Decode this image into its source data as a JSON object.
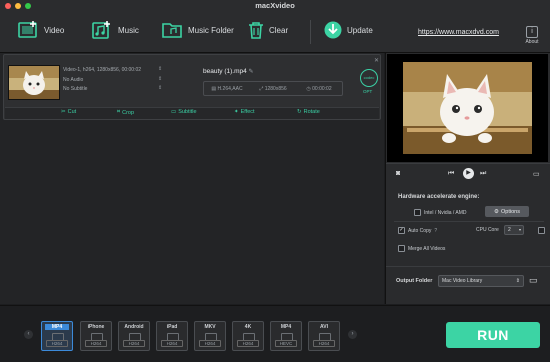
{
  "window": {
    "title": "macXvideo"
  },
  "toolbar": {
    "video_label": "Video",
    "music_label": "Music",
    "music_folder_label": "Music Folder",
    "clear_label": "Clear",
    "update_label": "Update",
    "website_link": "https://www.macxdvd.com",
    "about_label": "About"
  },
  "file": {
    "video_info": "Video-1, h264, 1280x856, 00:00:02",
    "audio_info": "No Audio",
    "subtitle_info": "No Subtitle",
    "name": "beauty (1).mp4",
    "codec": "H.264,AAC",
    "resolution": "1280x856",
    "duration": "00:00:02",
    "codec_badge": "codec",
    "opt_label": "OPT"
  },
  "edit_tools": {
    "cut": "Cut",
    "crop": "Crop",
    "subtitle": "Subtitle",
    "effect": "Effect",
    "rotate": "Rotate"
  },
  "settings": {
    "hw_title": "Hardware accelerate engine:",
    "hw_option": "Intel / Nvidia / AMD",
    "options_button": "Options",
    "auto_copy": "Auto Copy",
    "auto_copy_help": "?",
    "cpu_core_label": "CPU Core",
    "cpu_core_value": "2",
    "merge_label": "Merge All Videos",
    "output_folder_label": "Output Folder",
    "output_folder_value": "Mac Video Library"
  },
  "formats": [
    {
      "top": "MP4",
      "bottom": "H264"
    },
    {
      "top": "iPhone",
      "bottom": "H264"
    },
    {
      "top": "Android",
      "bottom": "H264"
    },
    {
      "top": "iPad",
      "bottom": "H264"
    },
    {
      "top": "MKV",
      "bottom": "H264"
    },
    {
      "top": "4K",
      "bottom": "H264"
    },
    {
      "top": "MP4",
      "bottom": "HEVC"
    },
    {
      "top": "AVI",
      "bottom": "H264"
    }
  ],
  "run_label": "RUN",
  "colors": {
    "accent": "#3cd4a4",
    "selected_format": "#3c8ad9"
  }
}
